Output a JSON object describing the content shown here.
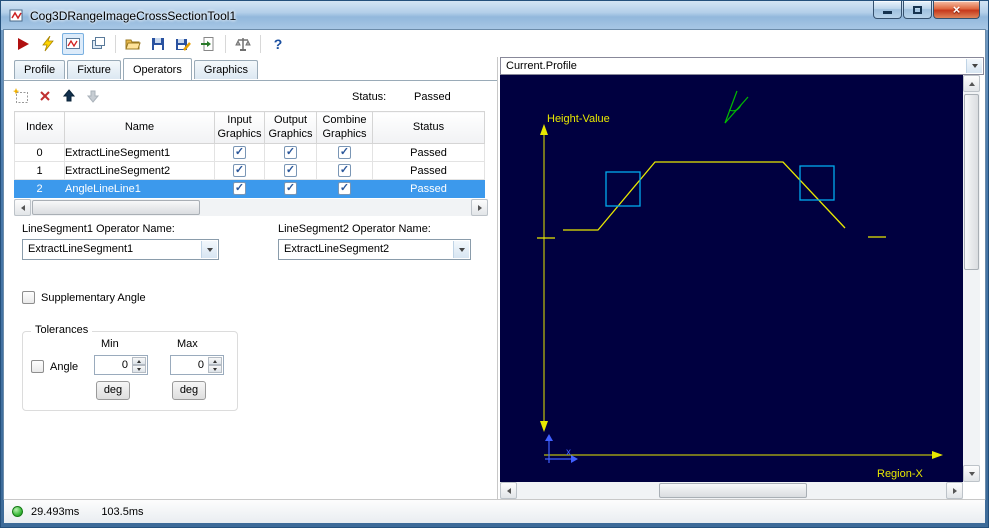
{
  "window": {
    "title": "Cog3DRangeImageCrossSectionTool1"
  },
  "toolbar": {
    "buttons": [
      {
        "name": "run-button",
        "icon": "play-icon"
      },
      {
        "name": "trigger-button",
        "icon": "lightning-icon"
      },
      {
        "name": "electrode-button",
        "icon": "electrode-icon"
      },
      {
        "name": "float-window-button",
        "icon": "window-icon"
      },
      {
        "name": "open-button",
        "icon": "open-folder-icon"
      },
      {
        "name": "save-button",
        "icon": "floppy-icon"
      },
      {
        "name": "save-as-button",
        "icon": "floppy-pencil-icon"
      },
      {
        "name": "import-button",
        "icon": "import-icon"
      },
      {
        "name": "calibrate-button",
        "icon": "scales-icon"
      },
      {
        "name": "help-button",
        "icon": "question-icon"
      }
    ],
    "help_glyph": "?"
  },
  "tabs": {
    "items": [
      {
        "label": "Profile"
      },
      {
        "label": "Fixture"
      },
      {
        "label": "Operators"
      },
      {
        "label": "Graphics"
      }
    ]
  },
  "operators": {
    "status_label": "Status:",
    "status_value": "Passed",
    "table": {
      "columns": [
        "Index",
        "Name",
        "Input Graphics",
        "Output Graphics",
        "Combine Graphics",
        "Status"
      ],
      "rows": [
        {
          "index": "0",
          "name": "ExtractLineSegment1",
          "input_graphics": true,
          "output_graphics": true,
          "combine_graphics": true,
          "status": "Passed",
          "selected": false
        },
        {
          "index": "1",
          "name": "ExtractLineSegment2",
          "input_graphics": true,
          "output_graphics": true,
          "combine_graphics": true,
          "status": "Passed",
          "selected": false
        },
        {
          "index": "2",
          "name": "AngleLineLine1",
          "input_graphics": true,
          "output_graphics": true,
          "combine_graphics": true,
          "status": "Passed",
          "selected": true
        }
      ],
      "check_glyph": "✓"
    },
    "line_segment1": {
      "label": "LineSegment1 Operator Name:",
      "value": "ExtractLineSegment1"
    },
    "line_segment2": {
      "label": "LineSegment2 Operator Name:",
      "value": "ExtractLineSegment2"
    },
    "supplementary_angle": {
      "label": "Supplementary Angle",
      "checked": false
    },
    "tolerances": {
      "title": "Tolerances",
      "angle": {
        "label": "Angle",
        "checked": false
      },
      "min": {
        "label": "Min",
        "value": "0",
        "unit": "deg"
      },
      "max": {
        "label": "Max",
        "value": "0",
        "unit": "deg"
      }
    }
  },
  "display": {
    "selector": "Current.Profile",
    "canvas": {
      "y_axis_label": "Height-Value",
      "x_axis_label": "Region-X",
      "origin_label": "x",
      "profile_color": "#e8e800",
      "marker_color": "#00aaee",
      "angle_color": "#00bb00",
      "background": "#000040"
    }
  },
  "statusbar": {
    "run_time": "29.493ms",
    "total_time": "103.5ms"
  }
}
